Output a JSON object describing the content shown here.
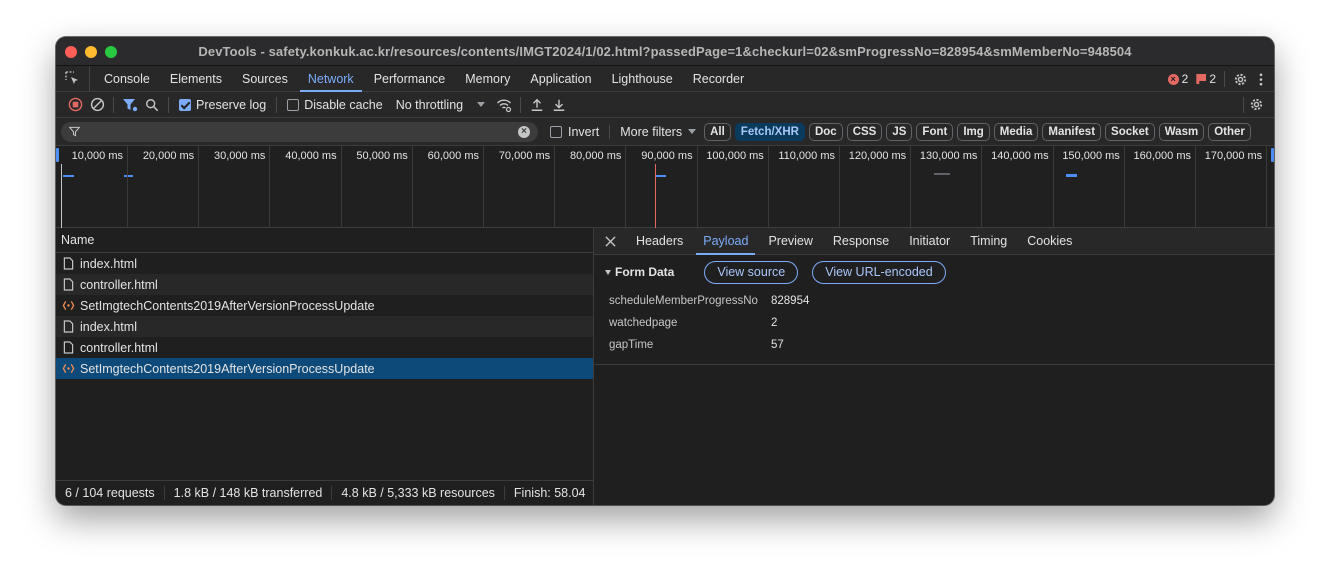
{
  "window": {
    "title": "DevTools - safety.konkuk.ac.kr/resources/contents/IMGT2024/1/02.html?passedPage=1&checkurl=02&smProgressNo=828954&smMemberNo=948504"
  },
  "tabs": [
    "Console",
    "Elements",
    "Sources",
    "Network",
    "Performance",
    "Memory",
    "Application",
    "Lighthouse",
    "Recorder"
  ],
  "active_tab": "Network",
  "badges": {
    "errors": "2",
    "issues": "2"
  },
  "toolbar": {
    "preserve_log_label": "Preserve log",
    "preserve_log_checked": true,
    "disable_cache_label": "Disable cache",
    "disable_cache_checked": false,
    "throttling": "No throttling"
  },
  "filter": {
    "placeholder": "",
    "value": "",
    "invert_label": "Invert",
    "more_filters_label": "More filters",
    "chips": [
      "All",
      "Fetch/XHR",
      "Doc",
      "CSS",
      "JS",
      "Font",
      "Img",
      "Media",
      "Manifest",
      "Socket",
      "Wasm",
      "Other"
    ],
    "selected_chip": "Fetch/XHR"
  },
  "timeline": {
    "ticks": [
      "10,000 ms",
      "20,000 ms",
      "30,000 ms",
      "40,000 ms",
      "50,000 ms",
      "60,000 ms",
      "70,000 ms",
      "80,000 ms",
      "90,000 ms",
      "100,000 ms",
      "110,000 ms",
      "120,000 ms",
      "130,000 ms",
      "140,000 ms",
      "150,000 ms",
      "160,000 ms",
      "170,000 ms"
    ]
  },
  "request_list": {
    "header": "Name",
    "rows": [
      {
        "name": "index.html",
        "type": "doc"
      },
      {
        "name": "controller.html",
        "type": "doc"
      },
      {
        "name": "SetImgtechContents2019AfterVersionProcessUpdate",
        "type": "xhr"
      },
      {
        "name": "index.html",
        "type": "doc"
      },
      {
        "name": "controller.html",
        "type": "doc"
      },
      {
        "name": "SetImgtechContents2019AfterVersionProcessUpdate",
        "type": "xhr"
      }
    ],
    "selected_index": 5
  },
  "status_bar": {
    "requests": "6 / 104 requests",
    "transferred": "1.8 kB / 148 kB transferred",
    "resources": "4.8 kB / 5,333 kB resources",
    "finish": "Finish: 58.04"
  },
  "detail_tabs": [
    "Headers",
    "Payload",
    "Preview",
    "Response",
    "Initiator",
    "Timing",
    "Cookies"
  ],
  "active_detail_tab": "Payload",
  "payload": {
    "section_title": "Form Data",
    "view_source_label": "View source",
    "view_url_encoded_label": "View URL-encoded",
    "fields": [
      {
        "key": "scheduleMemberProgressNo",
        "value": "828954"
      },
      {
        "key": "watchedpage",
        "value": "2"
      },
      {
        "key": "gapTime",
        "value": "57"
      }
    ]
  },
  "colors": {
    "accent": "#7cacf8",
    "selected_row": "#0d4a7a",
    "error": "#e46962"
  }
}
